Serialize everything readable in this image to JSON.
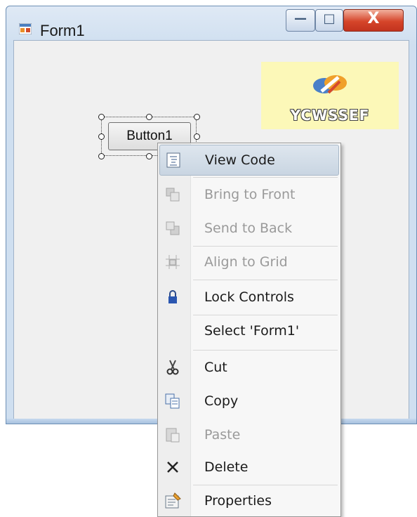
{
  "window": {
    "title": "Form1",
    "controls": {
      "minimize": "—",
      "maximize": "□",
      "close": "X"
    }
  },
  "logo": {
    "text": "YCWSSEF"
  },
  "button1": {
    "label": "Button1"
  },
  "context_menu": {
    "items": [
      {
        "label": "View Code",
        "icon": "view-code-icon",
        "enabled": true,
        "highlighted": true
      },
      {
        "label": "Bring to Front",
        "icon": "bring-to-front-icon",
        "enabled": false
      },
      {
        "label": "Send to Back",
        "icon": "send-to-back-icon",
        "enabled": false
      },
      {
        "label": "Align to Grid",
        "icon": "align-to-grid-icon",
        "enabled": false
      },
      {
        "label": "Lock Controls",
        "icon": "lock-icon",
        "enabled": true
      },
      {
        "label": "Select 'Form1'",
        "icon": "",
        "enabled": true
      },
      {
        "label": "Cut",
        "icon": "scissors-icon",
        "enabled": true
      },
      {
        "label": "Copy",
        "icon": "copy-icon",
        "enabled": true
      },
      {
        "label": "Paste",
        "icon": "paste-icon",
        "enabled": false
      },
      {
        "label": "Delete",
        "icon": "delete-x-icon",
        "enabled": true
      },
      {
        "label": "Properties",
        "icon": "properties-icon",
        "enabled": true
      }
    ]
  },
  "colors": {
    "highlight": "#c9d5e2",
    "disabled_text": "#9a9a9a",
    "logo_background": "#fcf8b8",
    "close_button": "#d6452a"
  }
}
